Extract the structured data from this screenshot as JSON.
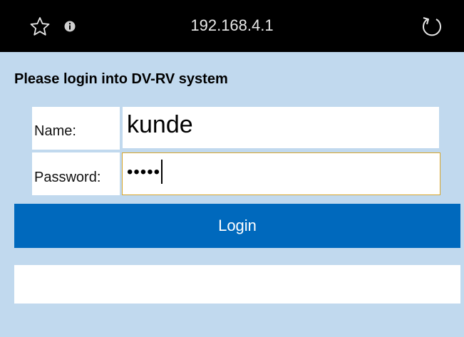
{
  "browser": {
    "url": "192.168.4.1",
    "icons": [
      "star-icon",
      "info-icon",
      "reload-icon"
    ]
  },
  "login": {
    "heading": "Please login into DV-RV system",
    "name_label": "Name:",
    "name_value": "kunde",
    "password_label": "Password:",
    "password_value": "•••••",
    "login_button": "Login",
    "message": ""
  },
  "colors": {
    "topbar": "#000000",
    "background": "#c1d9ee",
    "button": "#0069bd",
    "focus_border": "#d7a52a"
  }
}
